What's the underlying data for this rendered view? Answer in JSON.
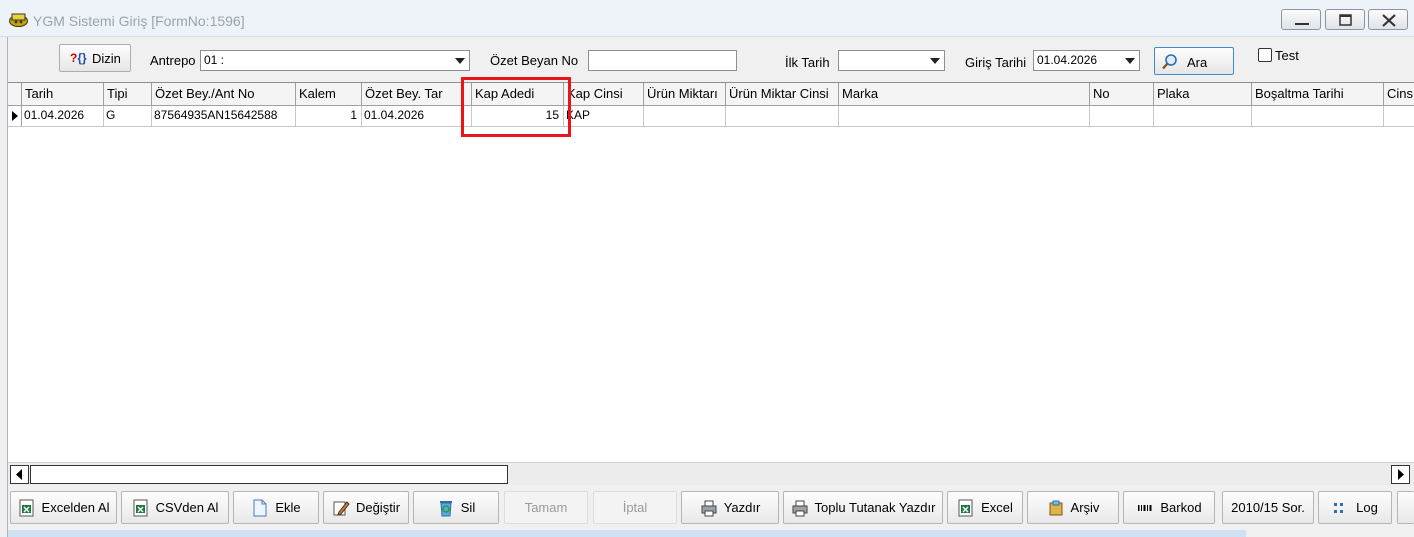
{
  "window": {
    "title": "YGM Sistemi Giriş [FormNo:1596]"
  },
  "toolbar": {
    "dizin_label": "Dizin",
    "antrepo_label": "Antrepo",
    "antrepo_value": "01 :",
    "ozet_beyan_label": "Özet Beyan No",
    "ozet_beyan_value": "",
    "ilk_tarih_label": "İlk Tarih",
    "ilk_tarih_value": "",
    "giris_tarihi_label": "Giriş Tarihi",
    "giris_tarihi_value": "01.04.2026",
    "ara_label": "Ara",
    "test_label": "Test"
  },
  "grid": {
    "columns": [
      "Tarih",
      "Tipi",
      "Özet Bey./Ant No",
      "Kalem",
      "Özet Bey. Tar",
      "Kap Adedi",
      "Kap Cinsi",
      "Ürün Miktarı",
      "Ürün Miktar Cinsi",
      "Marka",
      "No",
      "Plaka",
      "Boşaltma Tarihi",
      "Cins"
    ],
    "rows": [
      [
        "01.04.2026",
        "G",
        "87564935AN15642588",
        "1",
        "01.04.2026",
        "15",
        "KAP",
        "",
        "",
        "",
        "",
        "",
        "",
        ""
      ]
    ]
  },
  "bottom": {
    "excelden_al": "Excelden Al",
    "csvden_al": "CSVden Al",
    "ekle": "Ekle",
    "degistir": "Değiştir",
    "sil": "Sil",
    "tamam": "Tamam",
    "iptal": "İptal",
    "yazdir": "Yazdır",
    "toplu_tutanak": "Toplu Tutanak Yazdır",
    "excel": "Excel",
    "arsiv": "Arşiv",
    "barkod": "Barkod",
    "sorgu": "2010/15 Sor.",
    "log": "Log"
  },
  "colors": {
    "highlight": "#e8151b",
    "titlebar": "#eef3fa"
  }
}
